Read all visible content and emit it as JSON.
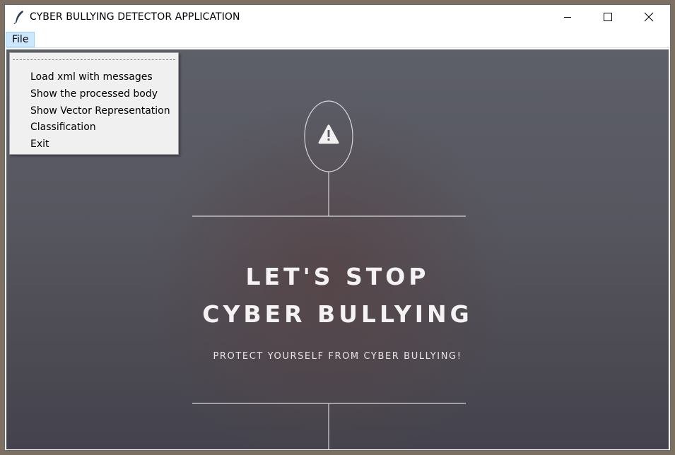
{
  "window": {
    "title": "CYBER BULLYING DETECTOR APPLICATION",
    "app_icon": "feather-icon",
    "controls": [
      "minimize-icon",
      "maximize-icon",
      "close-icon"
    ]
  },
  "menubar": {
    "file_label": "File",
    "file_menu_open": true,
    "file_menu_items": [
      "Load xml with messages",
      "Show the processed body",
      "Show Vector Representation",
      "Classification",
      "Exit"
    ]
  },
  "hero": {
    "icon": "warning-triangle-icon",
    "headline_line1": "LET'S STOP",
    "headline_line2": "CYBER BULLYING",
    "subheadline": "PROTECT YOURSELF FROM CYBER BULLYING!"
  },
  "colors": {
    "menu_highlight": "#cce8ff",
    "menu_background": "#f0f0f0",
    "hero_text": "#f4f2f2"
  }
}
